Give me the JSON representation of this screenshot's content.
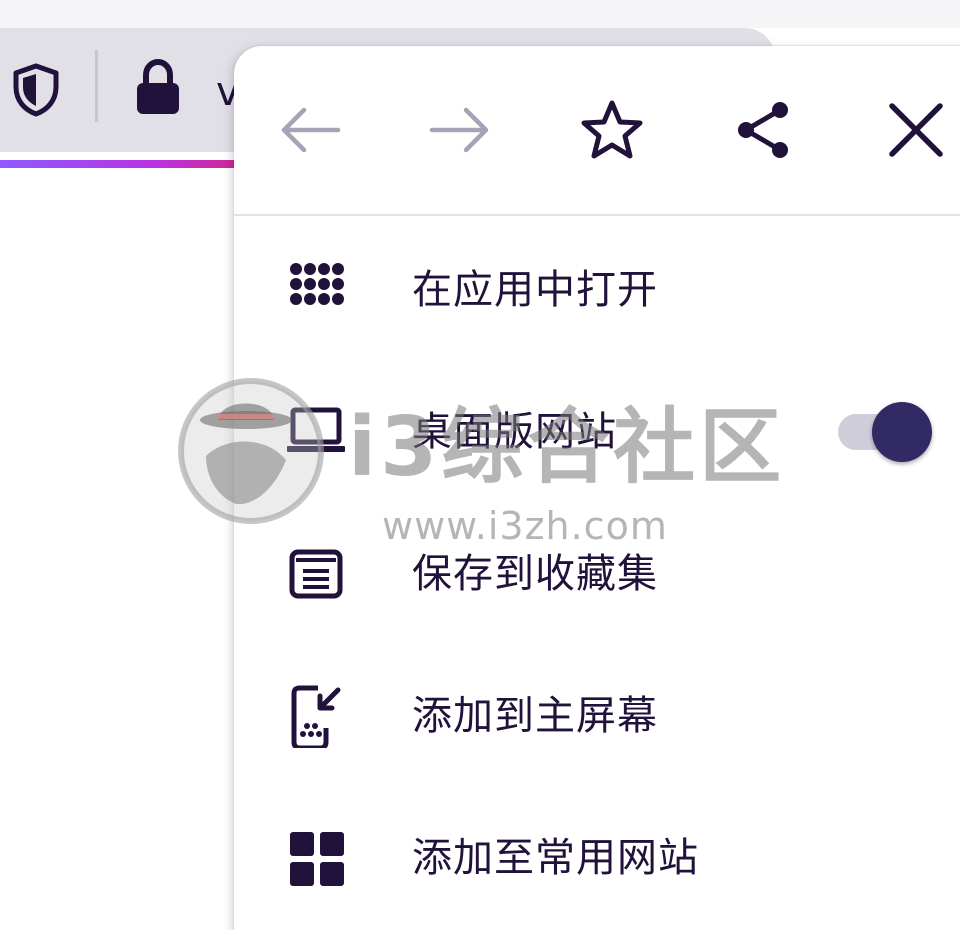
{
  "toolbar": {
    "url_partial": "v",
    "icons": {
      "shield": "tracking-protection-shield-icon",
      "lock": "lock-icon"
    }
  },
  "menu": {
    "nav": {
      "back": "back-arrow-icon",
      "forward": "forward-arrow-icon",
      "bookmark": "star-icon",
      "share": "share-icon",
      "close": "close-icon"
    },
    "items": [
      {
        "label": "在应用中打开",
        "icon": "app-grid-dots-icon"
      },
      {
        "label": "桌面版网站",
        "icon": "laptop-icon",
        "toggle_on": true
      },
      {
        "label": "保存到收藏集",
        "icon": "collection-icon"
      },
      {
        "label": "添加到主屏幕",
        "icon": "add-to-homescreen-icon"
      },
      {
        "label": "添加至常用网站",
        "icon": "top-sites-grid-icon"
      }
    ]
  },
  "watermark": {
    "title": "i3综合社区",
    "url": "www.i3zh.com"
  },
  "colors": {
    "ink": "#20123a",
    "toolbar_bg": "#e1e0e7",
    "toggle_knob": "#312a65",
    "toggle_track": "#cfcdd9",
    "nav_disabled": "#a7a3b6"
  }
}
